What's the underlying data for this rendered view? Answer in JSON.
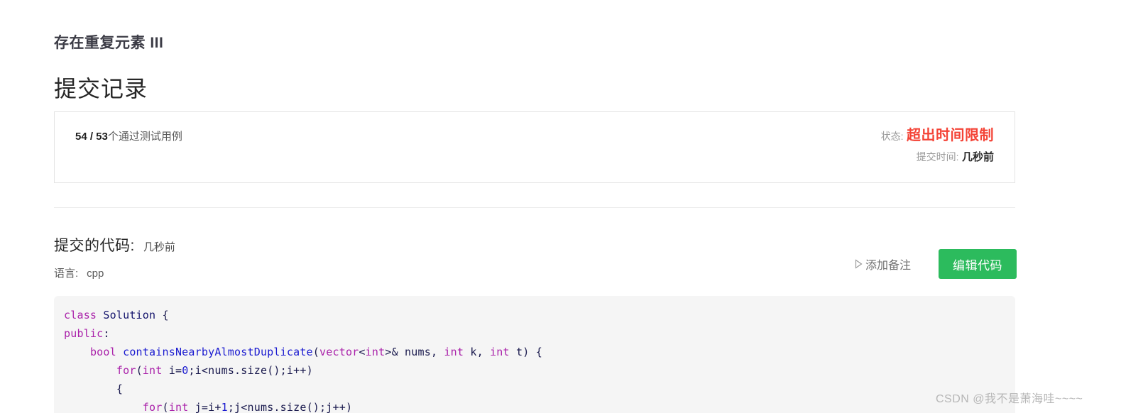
{
  "problem": {
    "title": "存在重复元素 III"
  },
  "heading": "提交记录",
  "submission_card": {
    "testcase_count": "54 / 53",
    "testcase_label": "个通过测试用例",
    "status_key": "状态:",
    "status_value": "超出时间限制",
    "status_color": "#f44336",
    "time_key": "提交时间:",
    "time_value": "几秒前"
  },
  "code_section": {
    "title": "提交的代码:",
    "submitted_time": "几秒前",
    "language_key": "语言:",
    "language_value": "cpp",
    "add_note_label": "添加备注",
    "add_note_icon": "triangle-right-icon",
    "edit_code_label": "编辑代码",
    "edit_code_color": "#2cbb5d"
  },
  "code": {
    "language": "cpp",
    "lines": [
      [
        {
          "t": "class ",
          "c": "kw"
        },
        {
          "t": "Solution ",
          "c": "cls"
        },
        {
          "t": "{",
          "c": "pl"
        }
      ],
      [
        {
          "t": "public",
          "c": "kw"
        },
        {
          "t": ":",
          "c": "pl"
        }
      ],
      [
        {
          "t": "    ",
          "c": "pl"
        },
        {
          "t": "bool ",
          "c": "kw"
        },
        {
          "t": "containsNearbyAlmostDuplicate",
          "c": "fn"
        },
        {
          "t": "(",
          "c": "pl"
        },
        {
          "t": "vector",
          "c": "kw"
        },
        {
          "t": "<",
          "c": "pl"
        },
        {
          "t": "int",
          "c": "kw"
        },
        {
          "t": ">& nums, ",
          "c": "pl"
        },
        {
          "t": "int",
          "c": "kw"
        },
        {
          "t": " k, ",
          "c": "pl"
        },
        {
          "t": "int",
          "c": "kw"
        },
        {
          "t": " t) {",
          "c": "pl"
        }
      ],
      [
        {
          "t": "        ",
          "c": "pl"
        },
        {
          "t": "for",
          "c": "kw"
        },
        {
          "t": "(",
          "c": "pl"
        },
        {
          "t": "int",
          "c": "kw"
        },
        {
          "t": " i=",
          "c": "pl"
        },
        {
          "t": "0",
          "c": "num"
        },
        {
          "t": ";i<nums.size();i++)",
          "c": "pl"
        }
      ],
      [
        {
          "t": "        {",
          "c": "pl"
        }
      ],
      [
        {
          "t": "            ",
          "c": "pl"
        },
        {
          "t": "for",
          "c": "kw"
        },
        {
          "t": "(",
          "c": "pl"
        },
        {
          "t": "int",
          "c": "kw"
        },
        {
          "t": " j=i+",
          "c": "pl"
        },
        {
          "t": "1",
          "c": "num"
        },
        {
          "t": ";j<nums.size();j++)",
          "c": "pl"
        }
      ]
    ]
  },
  "watermark": "CSDN @我不是萧海哇~~~~"
}
